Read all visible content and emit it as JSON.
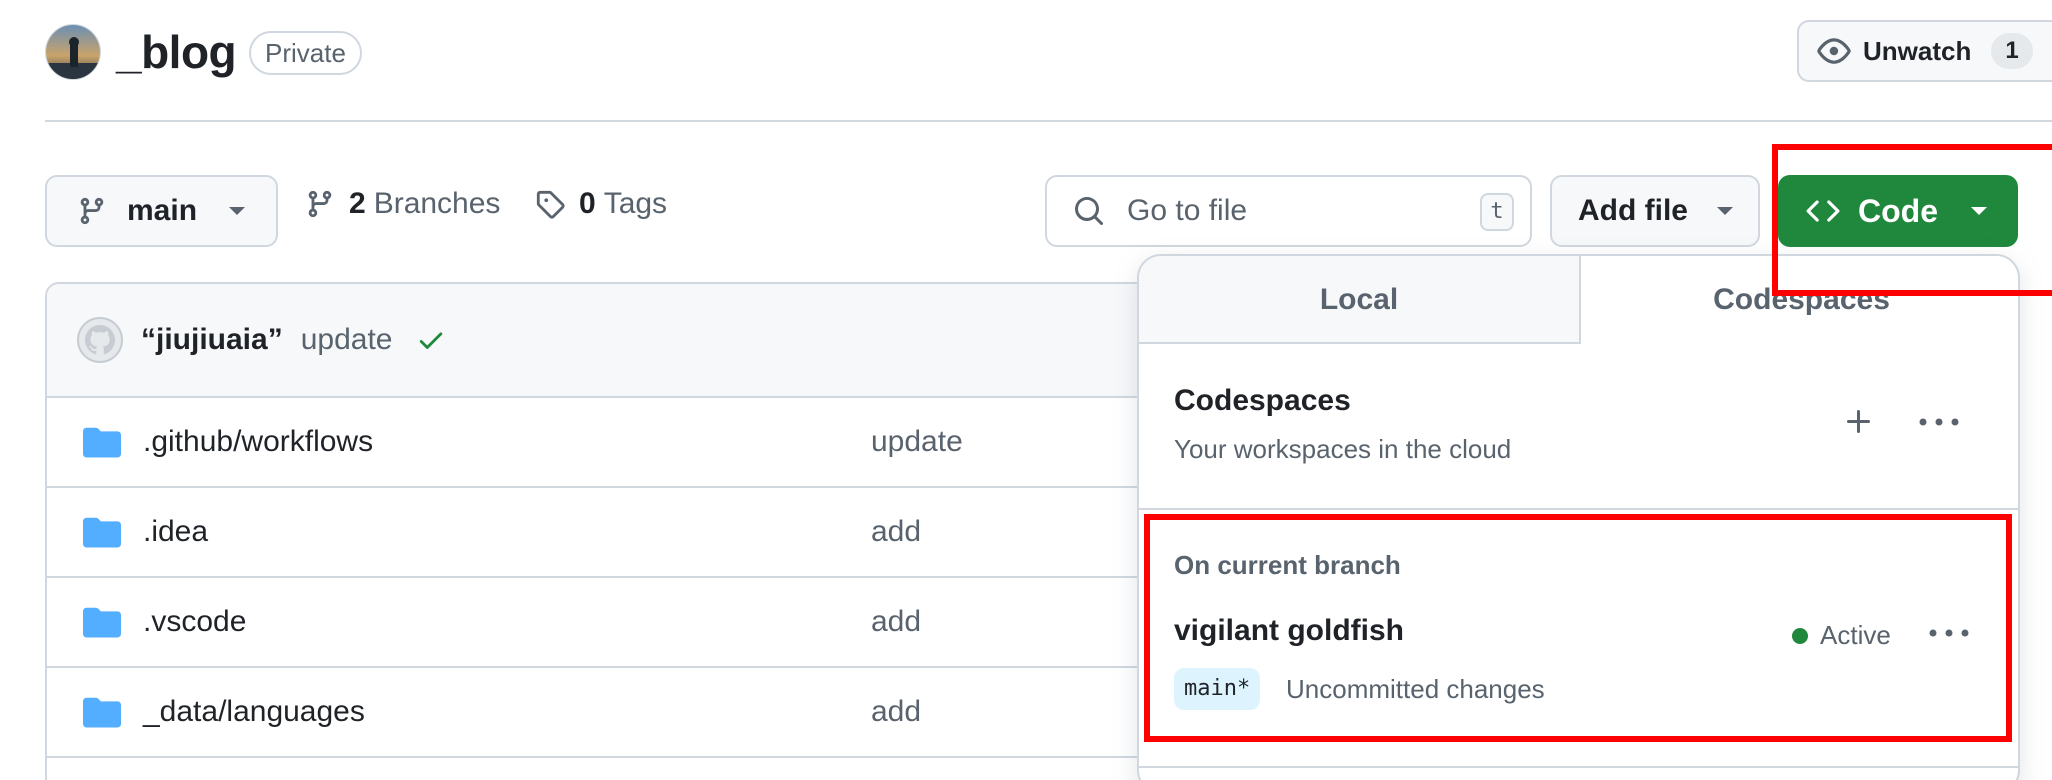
{
  "header": {
    "repo_name": "_blog",
    "visibility_badge": "Private",
    "watch_label": "Unwatch",
    "watch_count": "1"
  },
  "toolbar": {
    "branch_name": "main",
    "branches_count": "2",
    "branches_label": "Branches",
    "tags_count": "0",
    "tags_label": "Tags",
    "search_placeholder": "Go to file",
    "search_shortcut": "t",
    "add_file_label": "Add file",
    "code_label": "Code"
  },
  "latest_commit": {
    "author": "“jiujiuaia”",
    "message": "update",
    "status": "success"
  },
  "files": [
    {
      "name": ".github/workflows",
      "message": "update",
      "type": "folder"
    },
    {
      "name": ".idea",
      "message": "add",
      "type": "folder"
    },
    {
      "name": ".vscode",
      "message": "add",
      "type": "folder"
    },
    {
      "name": "_data/languages",
      "message": "add",
      "type": "folder"
    }
  ],
  "code_panel": {
    "tabs": [
      {
        "label": "Local",
        "selected": false
      },
      {
        "label": "Codespaces",
        "selected": true
      }
    ],
    "title": "Codespaces",
    "subtitle": "Your workspaces in the cloud",
    "section_label": "On current branch",
    "codespace": {
      "name": "vigilant goldfish",
      "status": "Active",
      "branch": "main*",
      "changes": "Uncommitted changes"
    }
  },
  "colors": {
    "accent_green": "#1f883d",
    "highlight_red": "#ff0000",
    "folder_blue": "#54aeff",
    "muted_text": "#59636e"
  }
}
